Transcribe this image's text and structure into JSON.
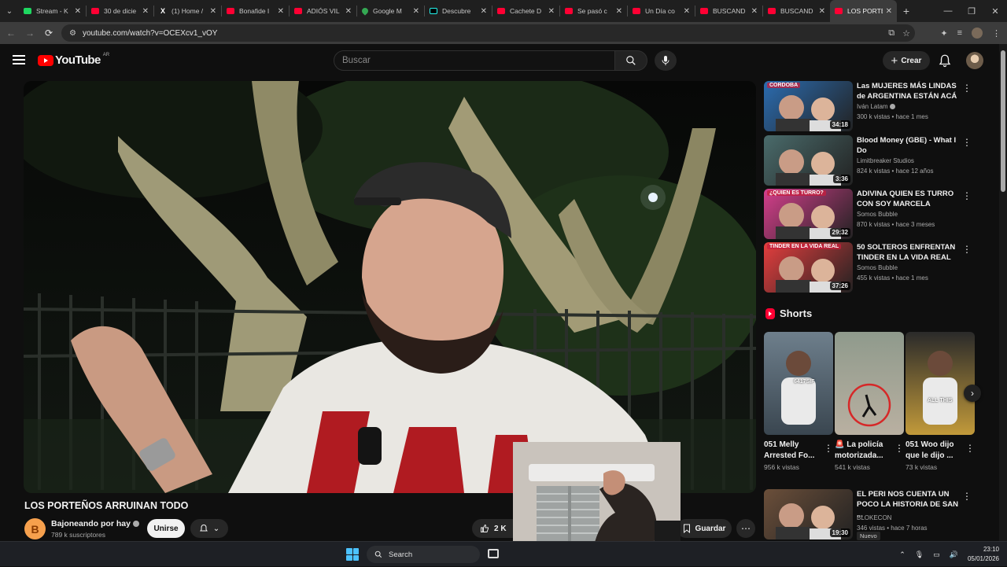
{
  "browser": {
    "tabs": [
      {
        "title": "Stream - K",
        "icon": "spotify-icon"
      },
      {
        "title": "30 de dicie",
        "icon": "youtube-icon"
      },
      {
        "title": "(1) Home /",
        "icon": "x-icon"
      },
      {
        "title": "Bonafide I",
        "icon": "youtube-icon"
      },
      {
        "title": "ADIÓS VIL",
        "icon": "youtube-icon"
      },
      {
        "title": "Google M",
        "icon": "maps-icon"
      },
      {
        "title": "Descubre",
        "icon": "tiktok-icon"
      },
      {
        "title": "Cachete D",
        "icon": "youtube-icon"
      },
      {
        "title": "Se pasó c",
        "icon": "youtube-icon"
      },
      {
        "title": "Un Día co",
        "icon": "youtube-icon"
      },
      {
        "title": "BUSCAND",
        "icon": "youtube-icon"
      },
      {
        "title": "BUSCAND",
        "icon": "youtube-icon"
      },
      {
        "title": "LOS PORTE",
        "icon": "youtube-icon",
        "active": true
      }
    ],
    "url": "youtube.com/watch?v=OCEXcv1_vOY"
  },
  "header": {
    "logo_text": "YouTube",
    "country_code": "AR",
    "search_placeholder": "Buscar",
    "create_label": "Crear"
  },
  "video": {
    "title": "LOS PORTEÑOS ARRUINAN TODO",
    "channel_initial": "B",
    "channel_name": "Bajoneando por hay",
    "subscribers": "789 k suscriptores",
    "join_label": "Unirse",
    "likes": "2 K",
    "save_label": "Guardar"
  },
  "recommendations": [
    {
      "title": "Las MUJERES MÁS LINDAS de ARGENTINA ESTÁN ACÁ",
      "channel": "Iván Latam",
      "verified": true,
      "meta": "300 k vistas • hace 1 mes",
      "duration": "34:18",
      "thumb_text": "CÓRDOBA",
      "accent": "#2b6cb0"
    },
    {
      "title": "Blood Money (GBE) - What I Do",
      "channel": "Limitbreaker Studios",
      "verified": false,
      "meta": "824 k vistas • hace 12 años",
      "duration": "3:36",
      "thumb_text": "",
      "accent": "#4a6b6b"
    },
    {
      "title": "ADIVINA QUIEN ES TURRO CON SOY MARCELA",
      "channel": "Somos Bubble",
      "verified": false,
      "meta": "870 k vistas • hace 3 meses",
      "duration": "29:32",
      "thumb_text": "¿QUIEN ES TURRO?",
      "accent": "#d53f8c"
    },
    {
      "title": "50 SOLTEROS ENFRENTAN TINDER EN LA VIDA REAL",
      "channel": "Somos Bubble",
      "verified": false,
      "meta": "455 k vistas • hace 1 mes",
      "duration": "37:26",
      "thumb_text": "TINDER EN LA VIDA REAL",
      "accent": "#e53e3e"
    },
    {
      "title": "EL PERI NOS CUENTA UN POCO LA HISTORIA DE SAN ...",
      "channel": "BLOKECON",
      "verified": false,
      "meta": "346 vistas • hace 7 horas",
      "duration": "19:30",
      "thumb_text": "",
      "accent": "#6b4f3a",
      "badge": "Nuevo"
    }
  ],
  "shorts": {
    "heading": "Shorts",
    "items": [
      {
        "title": "051 Melly Arrested Fo...",
        "views": "956 k vistas",
        "thumb_text": "6417SIF"
      },
      {
        "title": "La policía motorizada...",
        "views": "541 k vistas",
        "thumb_text": "",
        "emoji": "🚨"
      },
      {
        "title": "051 Woo dijo que le dijo ...",
        "views": "73 k vistas",
        "thumb_text": "ALL THIS"
      }
    ]
  },
  "taskbar": {
    "search_label": "Search",
    "time": "23:10",
    "date": "05/01/2026"
  }
}
